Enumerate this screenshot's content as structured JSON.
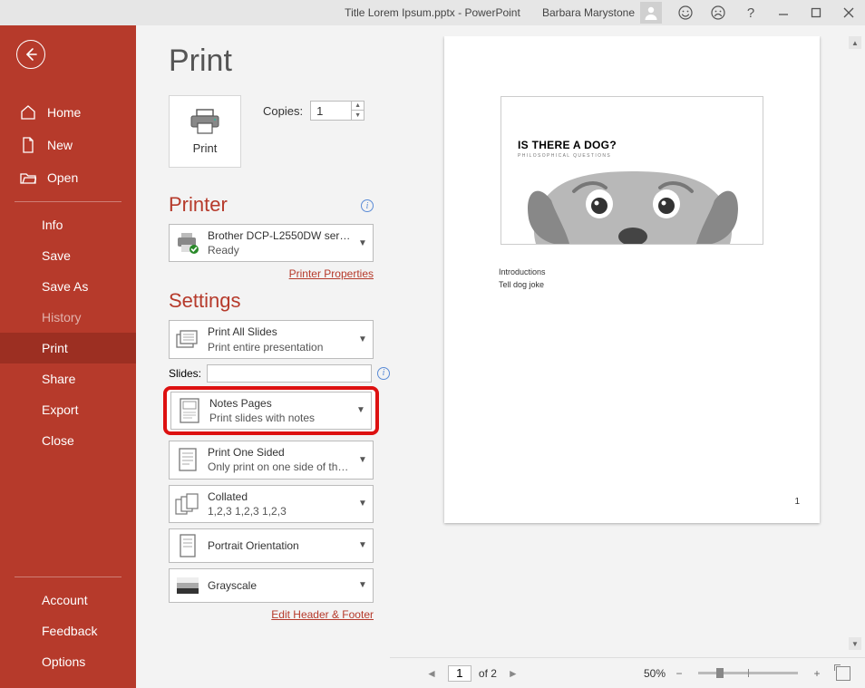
{
  "titlebar": {
    "title": "Title Lorem Ipsum.pptx  -  PowerPoint",
    "user": "Barbara Marystone"
  },
  "sidebar": {
    "home": "Home",
    "new": "New",
    "open": "Open",
    "info": "Info",
    "save": "Save",
    "saveas": "Save As",
    "history": "History",
    "print": "Print",
    "share": "Share",
    "export": "Export",
    "close": "Close",
    "account": "Account",
    "feedback": "Feedback",
    "options": "Options"
  },
  "page": {
    "title": "Print",
    "print_button": "Print",
    "copies_label": "Copies:",
    "copies_value": "1"
  },
  "printer": {
    "heading": "Printer",
    "name": "Brother DCP-L2550DW serie…",
    "status": "Ready",
    "properties_link": "Printer Properties"
  },
  "settings": {
    "heading": "Settings",
    "slides_label": "Slides:",
    "printall": {
      "t1": "Print All Slides",
      "t2": "Print entire presentation"
    },
    "notes": {
      "t1": "Notes Pages",
      "t2": "Print slides with notes"
    },
    "onesided": {
      "t1": "Print One Sided",
      "t2": "Only print on one side of th…"
    },
    "collated": {
      "t1": "Collated",
      "t2": "1,2,3     1,2,3     1,2,3"
    },
    "orientation": {
      "t1": "Portrait Orientation"
    },
    "color": {
      "t1": "Grayscale"
    },
    "edit_link": "Edit Header & Footer"
  },
  "preview": {
    "slide_title": "IS THERE A DOG?",
    "slide_subtitle": "PHILOSOPHICAL QUESTIONS",
    "note1": "Introductions",
    "note2": "Tell dog joke",
    "page_number": "1"
  },
  "nav": {
    "current": "1",
    "total": "of 2",
    "zoom": "50%"
  }
}
